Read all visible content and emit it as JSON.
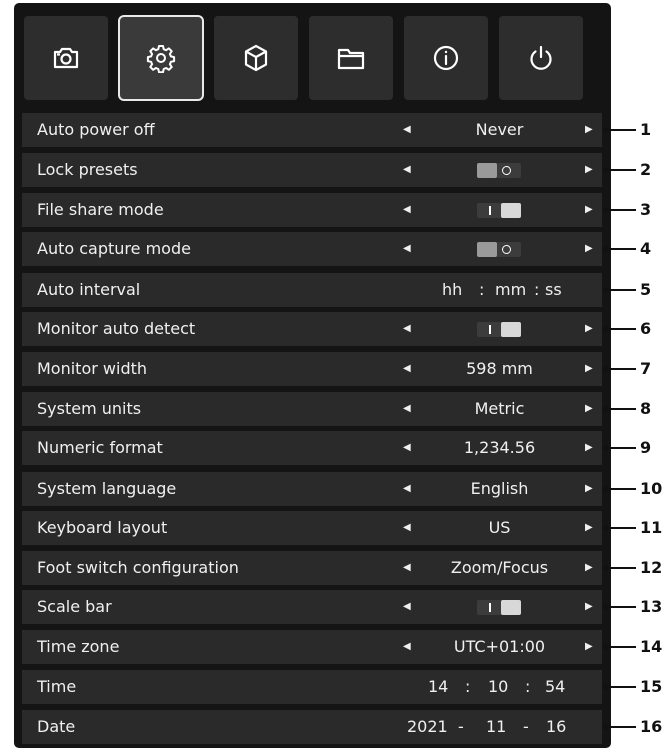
{
  "tabs": [
    {
      "icon": "camera-icon"
    },
    {
      "icon": "gear-icon",
      "active": true
    },
    {
      "icon": "cube-icon"
    },
    {
      "icon": "folder-icon"
    },
    {
      "icon": "info-icon"
    },
    {
      "icon": "power-icon"
    }
  ],
  "settings": {
    "auto_power_off": {
      "label": "Auto power off",
      "value": "Never"
    },
    "lock_presets": {
      "label": "Lock presets",
      "toggle": "off"
    },
    "file_share_mode": {
      "label": "File share mode",
      "toggle": "on"
    },
    "auto_capture_mode": {
      "label": "Auto capture mode",
      "toggle": "off"
    },
    "auto_interval": {
      "label": "Auto interval",
      "hh": "hh",
      "mm": "mm",
      "ss": "ss",
      "sep": ":"
    },
    "monitor_auto_detect": {
      "label": "Monitor auto detect",
      "toggle": "on"
    },
    "monitor_width": {
      "label": "Monitor width",
      "value": "598 mm"
    },
    "system_units": {
      "label": "System units",
      "value": "Metric"
    },
    "numeric_format": {
      "label": "Numeric format",
      "value": "1,234.56"
    },
    "system_language": {
      "label": "System language",
      "value": "English"
    },
    "keyboard_layout": {
      "label": "Keyboard layout",
      "value": "US"
    },
    "foot_switch": {
      "label": "Foot switch configuration",
      "value": "Zoom/Focus"
    },
    "scale_bar": {
      "label": "Scale bar",
      "toggle": "on"
    },
    "time_zone": {
      "label": "Time zone",
      "value": "UTC+01:00"
    },
    "time": {
      "label": "Time",
      "h": "14",
      "m": "10",
      "s": "54",
      "sep": ":"
    },
    "date": {
      "label": "Date",
      "y": "2021",
      "mo": "11",
      "d": "16",
      "sep": "-"
    }
  },
  "callouts": [
    "1",
    "2",
    "3",
    "4",
    "5",
    "6",
    "7",
    "8",
    "9",
    "10",
    "11",
    "12",
    "13",
    "14",
    "15",
    "16"
  ]
}
